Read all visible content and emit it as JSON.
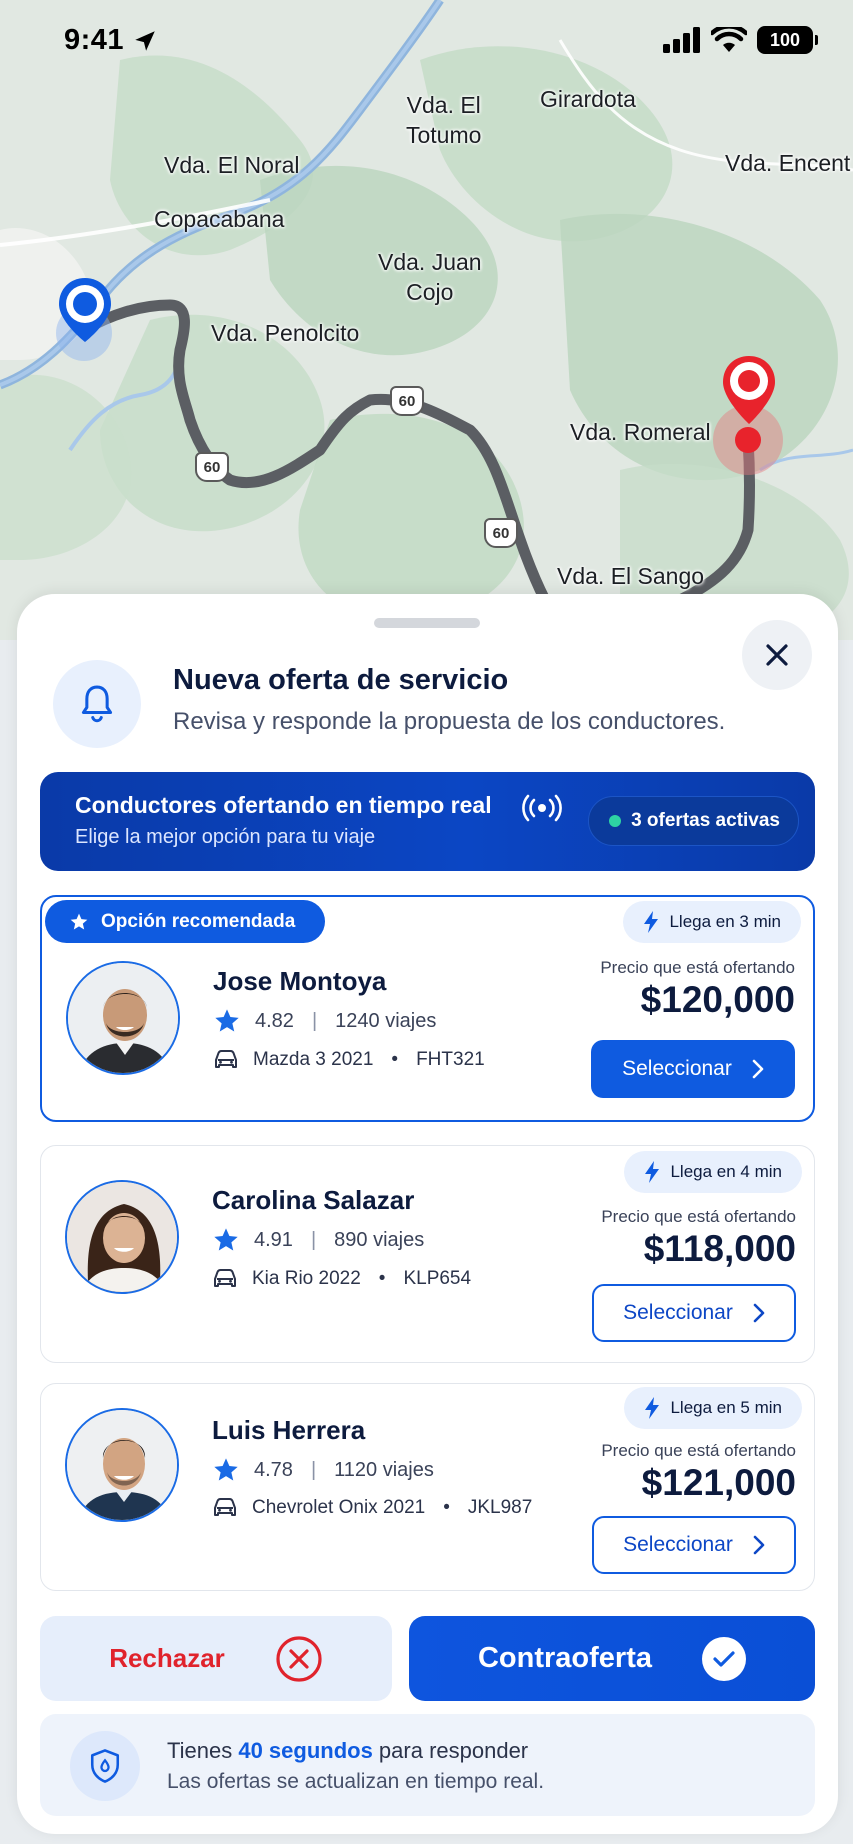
{
  "status_bar": {
    "time": "9:41",
    "battery": "100"
  },
  "map": {
    "labels": [
      {
        "id": "el-noral",
        "text": "Vda. El Noral"
      },
      {
        "id": "copacabana",
        "text": "Copacabana"
      },
      {
        "id": "el-totumo",
        "text": "Vda. El\nTotumo"
      },
      {
        "id": "girardota",
        "text": "Girardota"
      },
      {
        "id": "encent",
        "text": "Vda. Encent"
      },
      {
        "id": "juan-cojo",
        "text": "Vda. Juan\nCojo"
      },
      {
        "id": "penolcito",
        "text": "Vda. Penolcito"
      },
      {
        "id": "romeral",
        "text": "Vda. Romeral"
      },
      {
        "id": "el-sango",
        "text": "Vda. El Sango"
      }
    ],
    "route_shields": [
      "60",
      "60",
      "60"
    ]
  },
  "sheet": {
    "title": "Nueva oferta de servicio",
    "subtitle": "Revisa y responde la propuesta de los conductores."
  },
  "live_banner": {
    "title": "Conductores ofertando en tiempo real",
    "subtitle": "Elige la mejor opción para tu viaje",
    "badge": "3 ofertas activas"
  },
  "offers": [
    {
      "recommended_label": "Opción recomendada",
      "name": "Jose Montoya",
      "rating": "4.82",
      "trips": "1240 viajes",
      "car": "Mazda 3 2021",
      "plate": "FHT321",
      "eta": "Llega en 3 min",
      "price_label": "Precio que está ofertando",
      "price": "$120,000",
      "select_label": "Seleccionar"
    },
    {
      "name": "Carolina Salazar",
      "rating": "4.91",
      "trips": "890 viajes",
      "car": "Kia Rio 2022",
      "plate": "KLP654",
      "eta": "Llega en 4 min",
      "price_label": "Precio que está ofertando",
      "price": "$118,000",
      "select_label": "Seleccionar"
    },
    {
      "name": "Luis Herrera",
      "rating": "4.78",
      "trips": "1120 viajes",
      "car": "Chevrolet Onix 2021",
      "plate": "JKL987",
      "eta": "Llega en 5 min",
      "price_label": "Precio que está ofertando",
      "price": "$121,000",
      "select_label": "Seleccionar"
    }
  ],
  "actions": {
    "reject": "Rechazar",
    "counter": "Contraoferta"
  },
  "timer": {
    "prefix": "Tienes ",
    "highlight": "40 segundos",
    "suffix": " para responder",
    "note": "Las ofertas se actualizan en tiempo real."
  },
  "colors": {
    "primary": "#0f5be0",
    "banner": "#0a3aa8",
    "reject": "#e0232c",
    "star": "#1a6be5",
    "dest_pin": "#e8232c",
    "origin_pin": "#0f5be0"
  },
  "icons": [
    "location-arrow-icon",
    "signal-icon",
    "wifi-icon",
    "battery-icon",
    "bell-icon",
    "close-icon",
    "live-broadcast-icon",
    "star-icon",
    "car-icon",
    "lightning-icon",
    "chevron-right-icon",
    "x-circle-icon",
    "check-icon",
    "shield-icon"
  ]
}
